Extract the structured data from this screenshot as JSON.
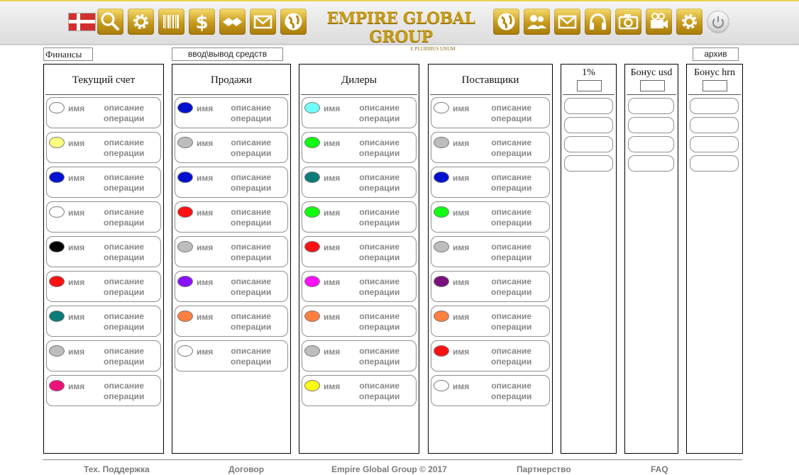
{
  "header": {
    "brand_name": "EMPIRE GLOBAL GROUP",
    "brand_tagline": "E PLURIBUS UNUM",
    "left_icons": [
      "flag-icon",
      "search-icon",
      "gear-icon",
      "barcode-icon",
      "dollar-icon",
      "handshake-icon",
      "mail-icon"
    ],
    "right_icons": [
      "globe-icon",
      "users-icon",
      "mail-icon",
      "headphones-icon",
      "camera-icon",
      "video-camera-icon",
      "gear-icon",
      "power-icon"
    ],
    "accent": "#c89b12"
  },
  "toolbar": {
    "finance_label": "Финансы",
    "inout_label": "ввод\\вывод средств",
    "archive_label": "архив"
  },
  "columns": {
    "current": {
      "title": "Текущий счет",
      "items": [
        {
          "name": "имя",
          "desc1": "описание",
          "desc2": "операции",
          "color": "#ffffff"
        },
        {
          "name": "имя",
          "desc1": "описание",
          "desc2": "операции",
          "color": "#ffff80"
        },
        {
          "name": "имя",
          "desc1": "описание",
          "desc2": "операции",
          "color": "#0010d0"
        },
        {
          "name": "имя",
          "desc1": "описание",
          "desc2": "операции",
          "color": "#ffffff"
        },
        {
          "name": "имя",
          "desc1": "описание",
          "desc2": "операции",
          "color": "#000000"
        },
        {
          "name": "имя",
          "desc1": "описание",
          "desc2": "операции",
          "color": "#ff1010"
        },
        {
          "name": "имя",
          "desc1": "описание",
          "desc2": "операции",
          "color": "#0a7d7a"
        },
        {
          "name": "имя",
          "desc1": "описание",
          "desc2": "операции",
          "color": "#bdbdbd"
        },
        {
          "name": "имя",
          "desc1": "описание",
          "desc2": "операции",
          "color": "#f0107a"
        }
      ]
    },
    "sales": {
      "title": "Продажи",
      "items": [
        {
          "name": "имя",
          "desc1": "описание",
          "desc2": "операции",
          "color": "#0010d0"
        },
        {
          "name": "имя",
          "desc1": "описание",
          "desc2": "операции",
          "color": "#bdbdbd"
        },
        {
          "name": "имя",
          "desc1": "описание",
          "desc2": "операции",
          "color": "#0010d0"
        },
        {
          "name": "имя",
          "desc1": "описание",
          "desc2": "операции",
          "color": "#ff1010"
        },
        {
          "name": "имя",
          "desc1": "описание",
          "desc2": "операции",
          "color": "#bdbdbd"
        },
        {
          "name": "имя",
          "desc1": "описание",
          "desc2": "операции",
          "color": "#8a10ff"
        },
        {
          "name": "имя",
          "desc1": "описание",
          "desc2": "операции",
          "color": "#ff7f40"
        },
        {
          "name": "имя",
          "desc1": "описание",
          "desc2": "операции",
          "color": "#ffffff"
        }
      ]
    },
    "dealers": {
      "title": "Дилеры",
      "items": [
        {
          "name": "имя",
          "desc1": "описание",
          "desc2": "операции",
          "color": "#70ffff"
        },
        {
          "name": "имя",
          "desc1": "описание",
          "desc2": "операции",
          "color": "#10ff10"
        },
        {
          "name": "имя",
          "desc1": "описание",
          "desc2": "операции",
          "color": "#0a7d7a"
        },
        {
          "name": "имя",
          "desc1": "описание",
          "desc2": "операции",
          "color": "#10ff10"
        },
        {
          "name": "имя",
          "desc1": "описание",
          "desc2": "операции",
          "color": "#ff1010"
        },
        {
          "name": "имя",
          "desc1": "описание",
          "desc2": "операции",
          "color": "#ff10ff"
        },
        {
          "name": "имя",
          "desc1": "описание",
          "desc2": "операции",
          "color": "#ff7f40"
        },
        {
          "name": "имя",
          "desc1": "описание",
          "desc2": "операции",
          "color": "#bdbdbd"
        },
        {
          "name": "имя",
          "desc1": "описание",
          "desc2": "операции",
          "color": "#ffff10"
        }
      ]
    },
    "suppliers": {
      "title": "Поставщики",
      "items": [
        {
          "name": "имя",
          "desc1": "описание",
          "desc2": "операции",
          "color": "#ffffff"
        },
        {
          "name": "имя",
          "desc1": "описание",
          "desc2": "операции",
          "color": "#bdbdbd"
        },
        {
          "name": "имя",
          "desc1": "описание",
          "desc2": "операции",
          "color": "#0010d0"
        },
        {
          "name": "имя",
          "desc1": "описание",
          "desc2": "операции",
          "color": "#10ff10"
        },
        {
          "name": "имя",
          "desc1": "описание",
          "desc2": "операции",
          "color": "#bdbdbd"
        },
        {
          "name": "имя",
          "desc1": "описание",
          "desc2": "операции",
          "color": "#7a107a"
        },
        {
          "name": "имя",
          "desc1": "описание",
          "desc2": "операции",
          "color": "#ff7f40"
        },
        {
          "name": "имя",
          "desc1": "описание",
          "desc2": "операции",
          "color": "#ff1010"
        },
        {
          "name": "имя",
          "desc1": "описание",
          "desc2": "операции",
          "color": "#ffffff"
        }
      ]
    }
  },
  "mini_columns": {
    "percent": {
      "title": "1%"
    },
    "bonus_usd": {
      "title": "Бонус usd"
    },
    "bonus_hrn": {
      "title": "Бонус hrn"
    }
  },
  "footer": {
    "support": "Тех. Поддержка",
    "contract": "Договор",
    "copyright": "Empire Global Group © 2017",
    "partnership": "Партнерство",
    "faq": "FAQ"
  }
}
